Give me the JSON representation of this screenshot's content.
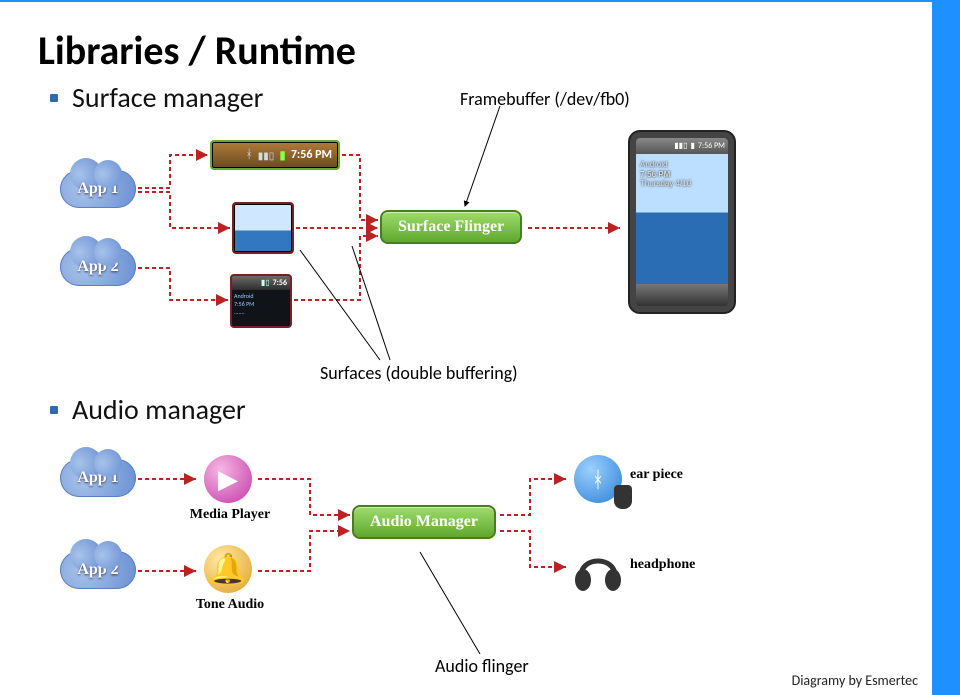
{
  "title": "Libraries / Runtime",
  "bullets": {
    "surface": "Surface manager",
    "audio": "Audio manager"
  },
  "annotations": {
    "framebuffer": "Framebuffer (/dev/fb0)",
    "surfaces_dbl": "Surfaces (double buffering)",
    "audio_flinger": "Audio flinger"
  },
  "credit": "Diagramy by Esmertec",
  "surface_diagram": {
    "app1": "App 1",
    "app2": "App 2",
    "statusbar_time": "7:56 PM",
    "flinger_box": "Surface Flinger",
    "phone": {
      "time": "7:56 PM",
      "carrier": "Android",
      "clock": "7:56 PM",
      "lines": "Thursday 4/10"
    }
  },
  "audio_diagram": {
    "app1": "App 1",
    "app2": "App 2",
    "media_player": "Media Player",
    "tone_audio": "Tone Audio",
    "manager_box": "Audio Manager",
    "ear_piece": "ear piece",
    "headphone": "headphone"
  }
}
